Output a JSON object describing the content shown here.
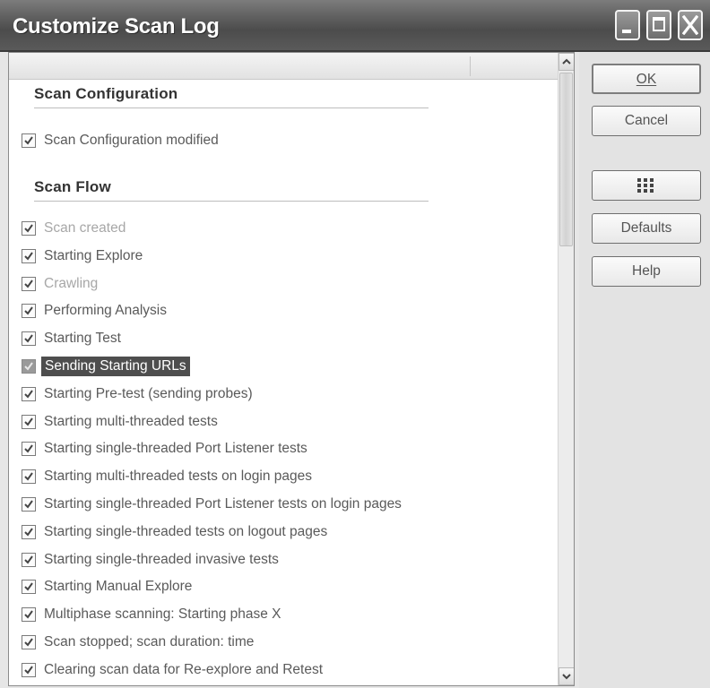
{
  "window": {
    "title": "Customize Scan Log",
    "controls": [
      "minimize",
      "maximize",
      "close"
    ]
  },
  "sections": [
    {
      "title": "Scan Configuration",
      "items": [
        {
          "label": "Scan Configuration modified",
          "checked": true,
          "dimmed": false,
          "selected": false
        }
      ]
    },
    {
      "title": "Scan Flow",
      "items": [
        {
          "label": "Scan created",
          "checked": true,
          "dimmed": true,
          "selected": false
        },
        {
          "label": "Starting Explore",
          "checked": true,
          "dimmed": false,
          "selected": false
        },
        {
          "label": "Crawling",
          "checked": true,
          "dimmed": true,
          "selected": false
        },
        {
          "label": "Performing Analysis",
          "checked": true,
          "dimmed": false,
          "selected": false
        },
        {
          "label": "Starting Test",
          "checked": true,
          "dimmed": false,
          "selected": false
        },
        {
          "label": "Sending Starting URLs",
          "checked": true,
          "dimmed": false,
          "selected": true
        },
        {
          "label": "Starting Pre-test (sending probes)",
          "checked": true,
          "dimmed": false,
          "selected": false
        },
        {
          "label": "Starting multi-threaded tests",
          "checked": true,
          "dimmed": false,
          "selected": false
        },
        {
          "label": "Starting single-threaded Port Listener tests",
          "checked": true,
          "dimmed": false,
          "selected": false
        },
        {
          "label": "Starting multi-threaded tests on login pages",
          "checked": true,
          "dimmed": false,
          "selected": false
        },
        {
          "label": "Starting single-threaded Port Listener tests on login pages",
          "checked": true,
          "dimmed": false,
          "selected": false
        },
        {
          "label": "Starting single-threaded tests on logout pages",
          "checked": true,
          "dimmed": false,
          "selected": false
        },
        {
          "label": "Starting single-threaded invasive tests",
          "checked": true,
          "dimmed": false,
          "selected": false
        },
        {
          "label": "Starting Manual Explore",
          "checked": true,
          "dimmed": false,
          "selected": false
        },
        {
          "label": "Multiphase scanning: Starting phase X",
          "checked": true,
          "dimmed": false,
          "selected": false
        },
        {
          "label": "Scan stopped; scan duration: time",
          "checked": true,
          "dimmed": false,
          "selected": false
        },
        {
          "label": "Clearing scan data for Re-explore and Retest",
          "checked": true,
          "dimmed": false,
          "selected": false
        }
      ]
    }
  ],
  "buttons": {
    "ok": "OK",
    "cancel": "Cancel",
    "defaults": "Defaults",
    "help": "Help"
  }
}
